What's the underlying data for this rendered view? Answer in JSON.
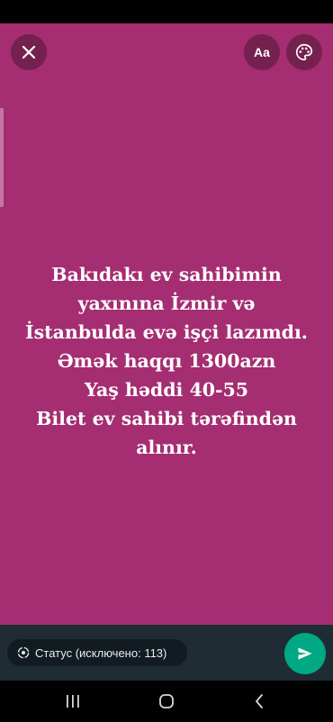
{
  "colors": {
    "background": "#a52d72",
    "button_bg": "#742150",
    "bottom_bar": "#1f2c33",
    "pill_bg": "#111b21",
    "send_accent": "#00a884"
  },
  "toolbar": {
    "close_icon": "close-icon",
    "font_label": "Aa",
    "palette_icon": "palette-icon"
  },
  "status": {
    "text": "Bakıdakı ev sahibimin\nyaxınına İzmir və\nİstanbulda evə işçi lazımdı.\nƏmək haqqı 1300azn\nYaş həddi 40-55\nBilet ev sahibi tərəfindən\nalınır."
  },
  "footer": {
    "audience_icon": "status-privacy-icon",
    "audience_label": "Статус (исключено: 113)",
    "send_icon": "send-icon"
  },
  "nav": {
    "recents_icon": "recents-icon",
    "home_icon": "home-icon",
    "back_icon": "back-icon"
  }
}
